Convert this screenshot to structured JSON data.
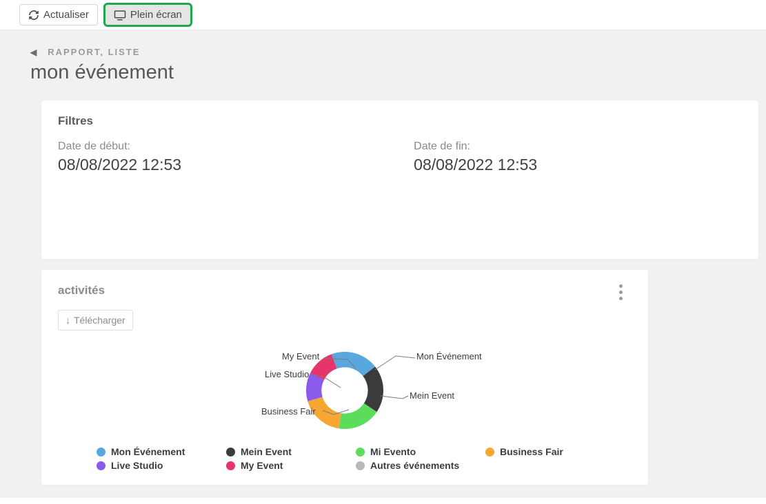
{
  "toolbar": {
    "refresh_label": "Actualiser",
    "fullscreen_label": "Plein écran"
  },
  "breadcrumb": "RAPPORT, LISTE",
  "page_title": "mon événement",
  "filters": {
    "title": "Filtres",
    "start_label": "Date de début:",
    "start_value": "08/08/2022 12:53",
    "end_label": "Date de fin:",
    "end_value": "08/08/2022 12:53"
  },
  "activities": {
    "title": "activités",
    "download_label": "Télécharger"
  },
  "chart_data": {
    "type": "pie",
    "series": [
      {
        "name": "Mon Événement",
        "value": 20,
        "color": "#5aa7de"
      },
      {
        "name": "Mein Event",
        "value": 20,
        "color": "#3b3b3b"
      },
      {
        "name": "Mi Evento",
        "value": 18,
        "color": "#5bdc5b"
      },
      {
        "name": "Business Fair",
        "value": 18,
        "color": "#f5a731"
      },
      {
        "name": "Live Studio",
        "value": 12,
        "color": "#8a5bea"
      },
      {
        "name": "My Event",
        "value": 12,
        "color": "#e7356b"
      },
      {
        "name": "Autres événements",
        "value": 0,
        "color": "#b9b9b9"
      }
    ],
    "inner_radius": 0.55,
    "label_placement": "outside"
  },
  "chart_labels": {
    "mon_evenement": "Mon Événement",
    "mein_event": "Mein Event",
    "mi_evento": "Mi Evento",
    "business_fair": "Business Fair",
    "live_studio": "Live Studio",
    "my_event": "My Event",
    "autres": "Autres événements"
  }
}
